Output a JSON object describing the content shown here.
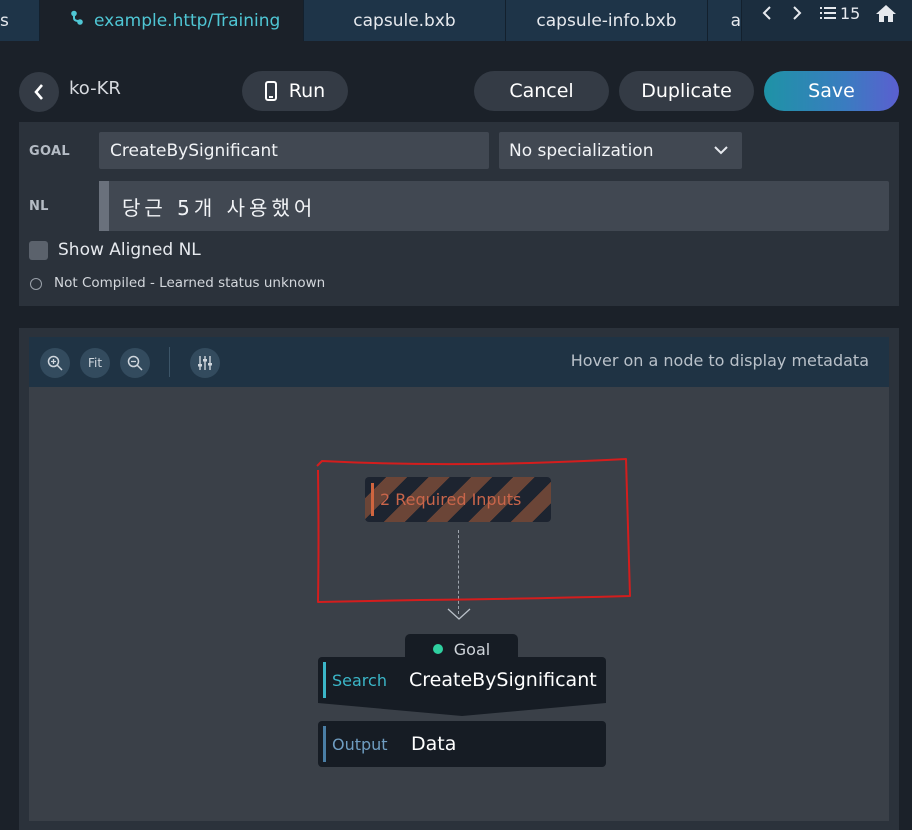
{
  "tabs": {
    "stub_label": "s",
    "active_label": "example.http/Training",
    "items": [
      "capsule.bxb",
      "capsule-info.bxb",
      "a"
    ],
    "count": "15"
  },
  "header": {
    "locale": "ko-KR",
    "run_label": "Run",
    "cancel_label": "Cancel",
    "duplicate_label": "Duplicate",
    "save_label": "Save"
  },
  "goal": {
    "label": "GOAL",
    "value": "CreateBySignificant",
    "specialization": "No specialization"
  },
  "nl": {
    "label": "NL",
    "value": "당근 5개 사용했어"
  },
  "aligned": {
    "label": "Show Aligned NL",
    "checked": false
  },
  "status": {
    "text": "Not Compiled - Learned status unknown"
  },
  "graph": {
    "fit_label": "Fit",
    "hover_hint": "Hover on a node to display metadata",
    "required_inputs": "2 Required Inputs",
    "goal_tag": "Goal",
    "search_kind": "Search",
    "search_name": "CreateBySignificant",
    "output_kind": "Output",
    "output_name": "Data"
  },
  "colors": {
    "accent": "#4fc6d4",
    "save_gradient_start": "#1e93a6",
    "save_gradient_end": "#5b5fd0",
    "annotation": "#d41d1d",
    "goal_dot": "#2fd0a0",
    "required_text": "#c9654a"
  }
}
